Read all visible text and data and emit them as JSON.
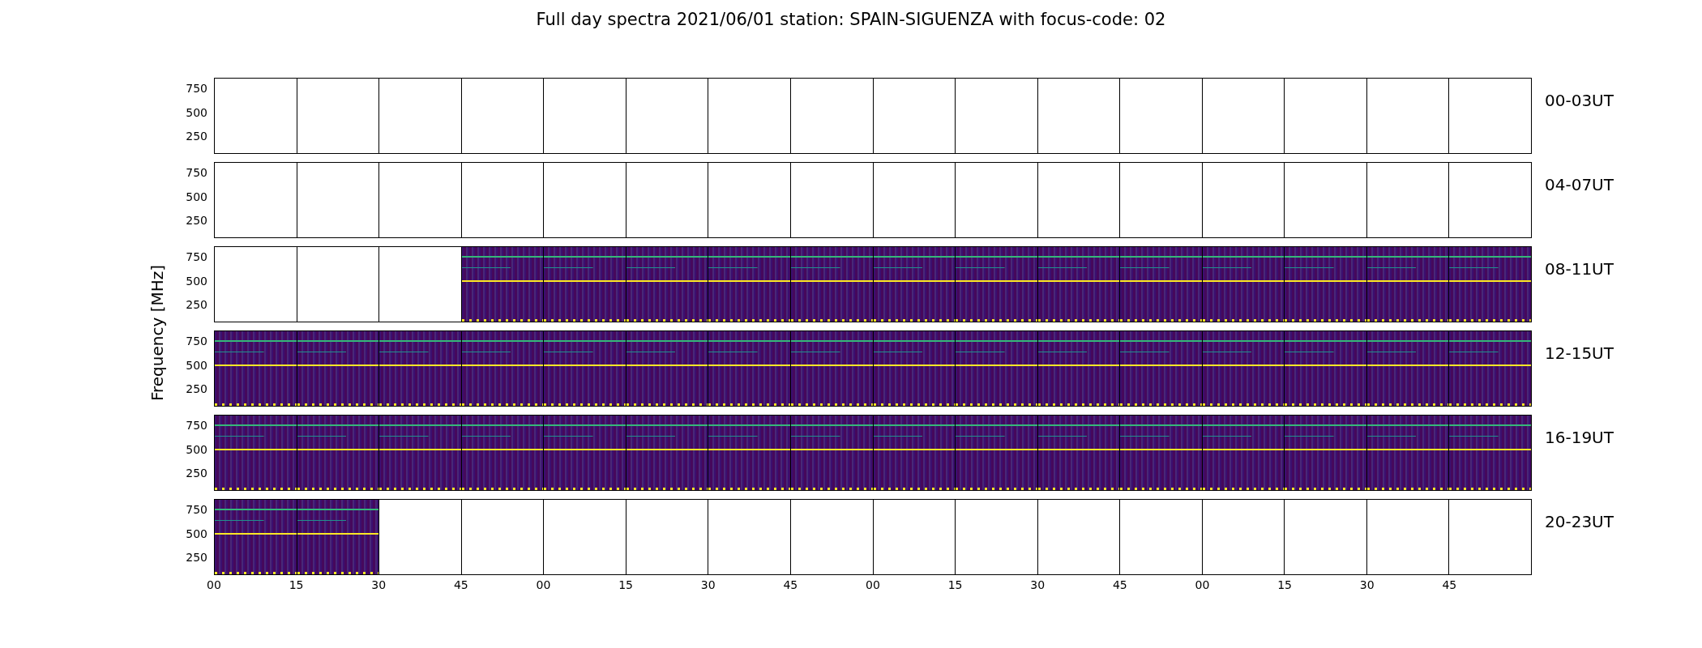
{
  "title": "Full day spectra 2021/06/01 station: SPAIN-SIGUENZA with focus-code: 02",
  "ylabel": "Frequency [MHz]",
  "rows": [
    {
      "label": "00-03UT",
      "yticks": [
        "750",
        "500",
        "250"
      ],
      "panels": [
        {
          "has_data": false
        },
        {
          "has_data": false
        },
        {
          "has_data": false
        },
        {
          "has_data": false
        },
        {
          "has_data": false
        },
        {
          "has_data": false
        },
        {
          "has_data": false
        },
        {
          "has_data": false
        },
        {
          "has_data": false
        },
        {
          "has_data": false
        },
        {
          "has_data": false
        },
        {
          "has_data": false
        },
        {
          "has_data": false
        },
        {
          "has_data": false
        },
        {
          "has_data": false
        },
        {
          "has_data": false
        }
      ]
    },
    {
      "label": "04-07UT",
      "yticks": [
        "750",
        "500",
        "250"
      ],
      "panels": [
        {
          "has_data": false
        },
        {
          "has_data": false
        },
        {
          "has_data": false
        },
        {
          "has_data": false
        },
        {
          "has_data": false
        },
        {
          "has_data": false
        },
        {
          "has_data": false
        },
        {
          "has_data": false
        },
        {
          "has_data": false
        },
        {
          "has_data": false
        },
        {
          "has_data": false
        },
        {
          "has_data": false
        },
        {
          "has_data": false
        },
        {
          "has_data": false
        },
        {
          "has_data": false
        },
        {
          "has_data": false
        }
      ]
    },
    {
      "label": "08-11UT",
      "yticks": [
        "750",
        "500",
        "250"
      ],
      "panels": [
        {
          "has_data": false
        },
        {
          "has_data": false
        },
        {
          "has_data": false
        },
        {
          "has_data": true
        },
        {
          "has_data": true
        },
        {
          "has_data": true
        },
        {
          "has_data": true
        },
        {
          "has_data": true
        },
        {
          "has_data": true
        },
        {
          "has_data": true
        },
        {
          "has_data": true
        },
        {
          "has_data": true
        },
        {
          "has_data": true
        },
        {
          "has_data": true
        },
        {
          "has_data": true
        },
        {
          "has_data": true
        }
      ]
    },
    {
      "label": "12-15UT",
      "yticks": [
        "750",
        "500",
        "250"
      ],
      "panels": [
        {
          "has_data": true
        },
        {
          "has_data": true
        },
        {
          "has_data": true
        },
        {
          "has_data": true
        },
        {
          "has_data": true
        },
        {
          "has_data": true
        },
        {
          "has_data": true
        },
        {
          "has_data": true
        },
        {
          "has_data": true
        },
        {
          "has_data": true
        },
        {
          "has_data": true
        },
        {
          "has_data": true
        },
        {
          "has_data": true
        },
        {
          "has_data": true
        },
        {
          "has_data": true
        },
        {
          "has_data": true
        }
      ]
    },
    {
      "label": "16-19UT",
      "yticks": [
        "750",
        "500",
        "250"
      ],
      "panels": [
        {
          "has_data": true
        },
        {
          "has_data": true
        },
        {
          "has_data": true
        },
        {
          "has_data": true
        },
        {
          "has_data": true
        },
        {
          "has_data": true
        },
        {
          "has_data": true
        },
        {
          "has_data": true
        },
        {
          "has_data": true
        },
        {
          "has_data": true
        },
        {
          "has_data": true
        },
        {
          "has_data": true
        },
        {
          "has_data": true
        },
        {
          "has_data": true
        },
        {
          "has_data": true
        },
        {
          "has_data": true
        }
      ]
    },
    {
      "label": "20-23UT",
      "yticks": [
        "750",
        "500",
        "250"
      ],
      "panels": [
        {
          "has_data": true
        },
        {
          "has_data": true
        },
        {
          "has_data": false
        },
        {
          "has_data": false
        },
        {
          "has_data": false
        },
        {
          "has_data": false
        },
        {
          "has_data": false
        },
        {
          "has_data": false
        },
        {
          "has_data": false
        },
        {
          "has_data": false
        },
        {
          "has_data": false
        },
        {
          "has_data": false
        },
        {
          "has_data": false
        },
        {
          "has_data": false
        },
        {
          "has_data": false
        },
        {
          "has_data": false
        }
      ]
    }
  ],
  "xticks": [
    "00",
    "15",
    "30",
    "45",
    "00",
    "15",
    "30",
    "45",
    "00",
    "15",
    "30",
    "45",
    "00",
    "15",
    "30",
    "45"
  ]
}
